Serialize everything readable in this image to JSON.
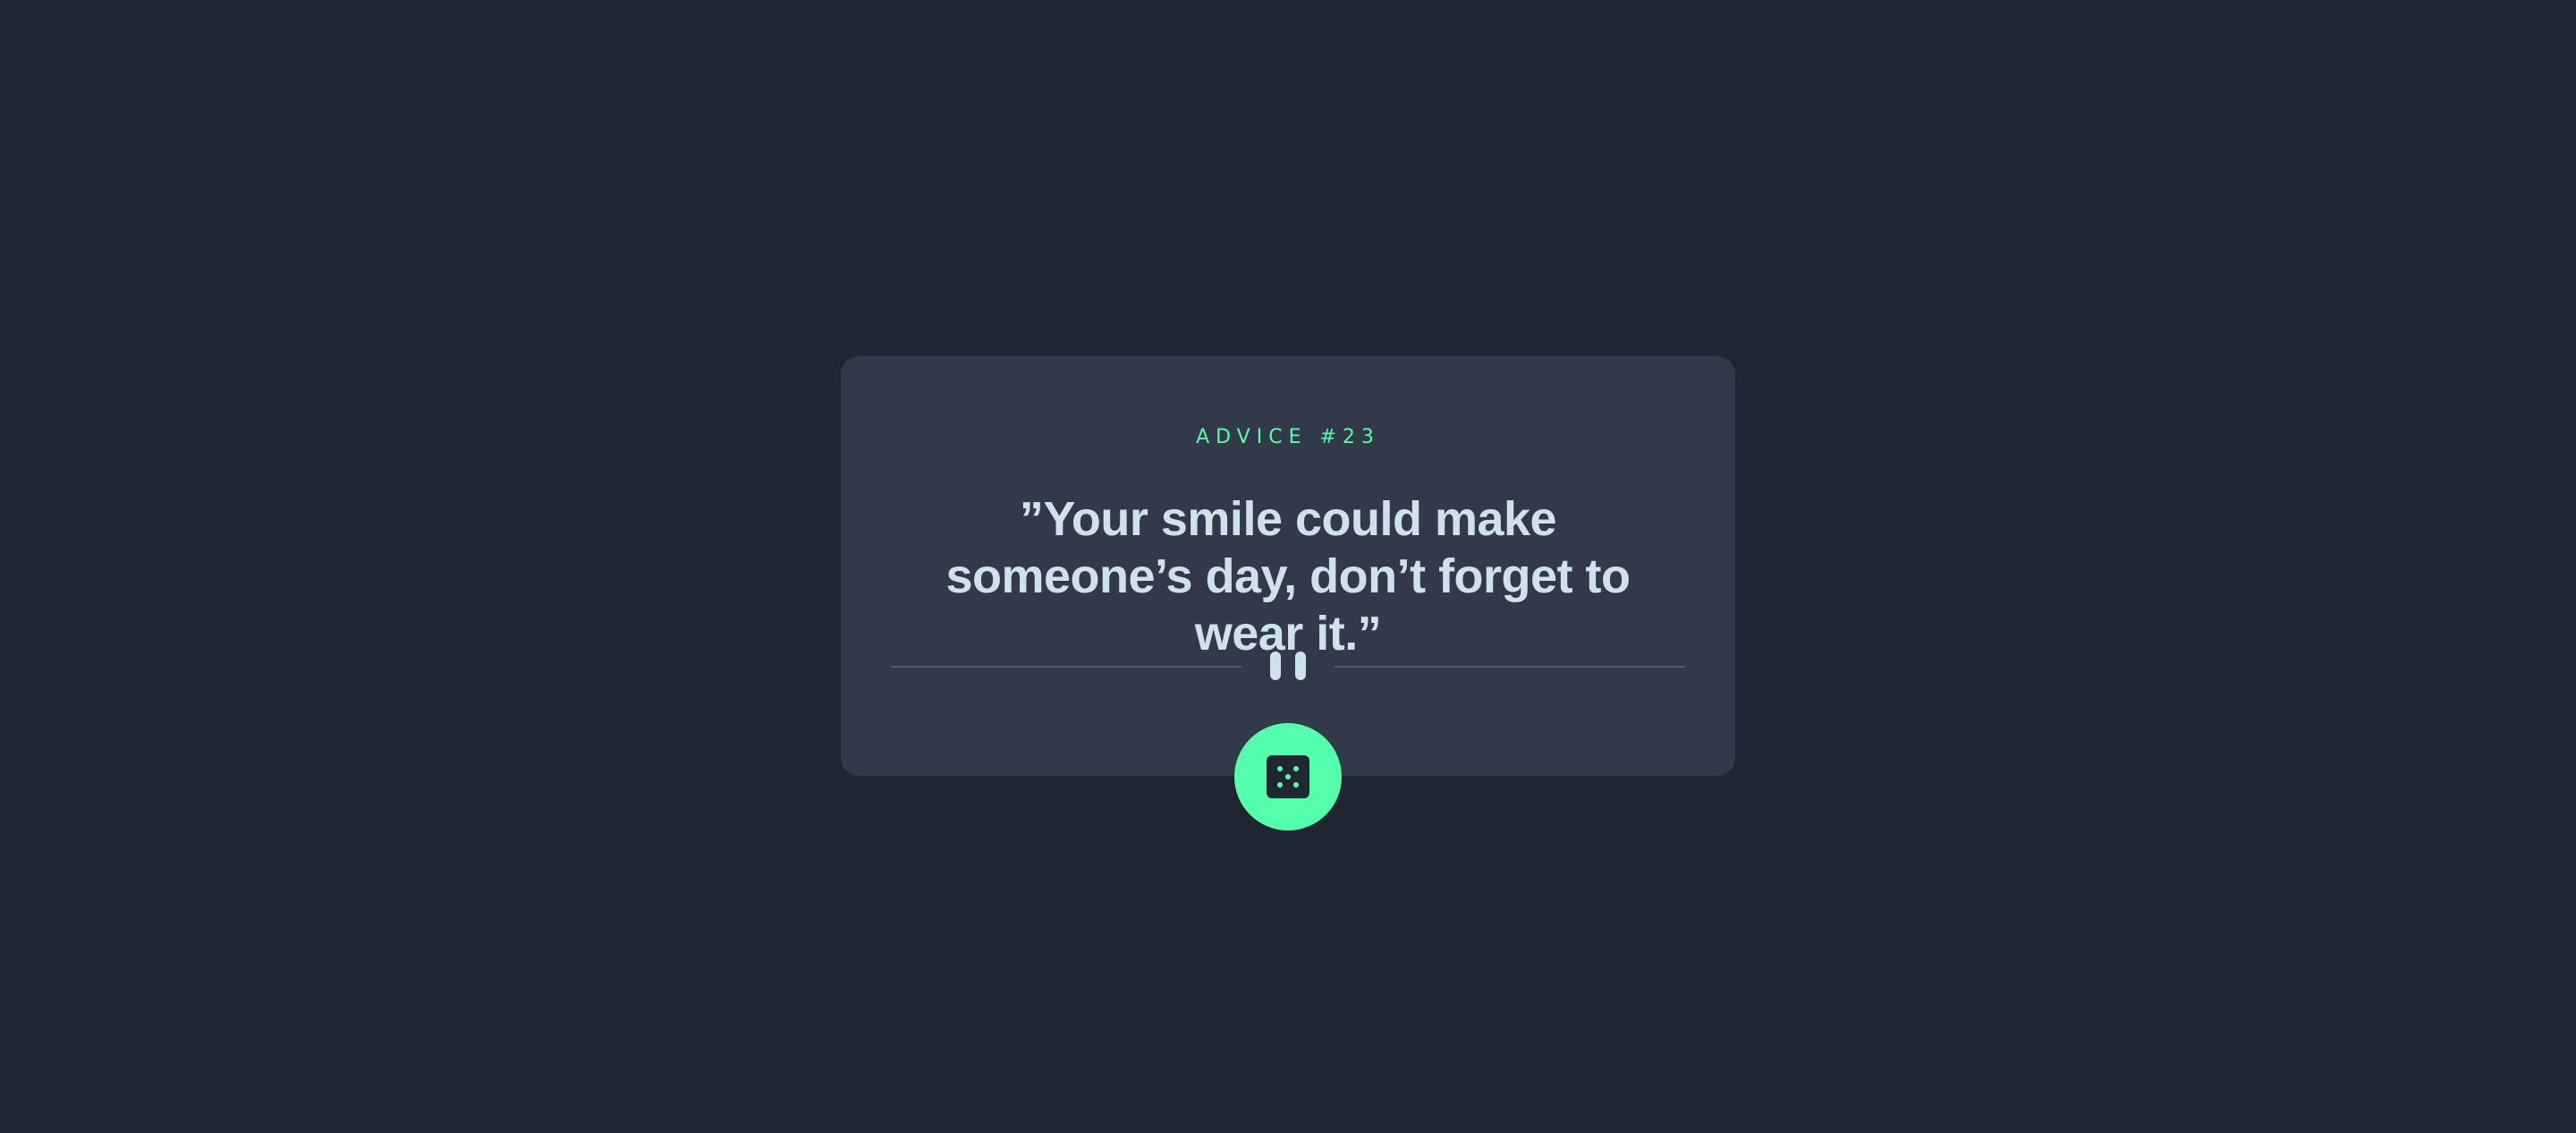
{
  "card": {
    "advice_label": "ADVICE #23",
    "quote": "”Your smile could make someone’s day, don’t forget to wear it.”"
  },
  "icons": {
    "divider": "pause-icon",
    "button": "dice-icon"
  },
  "colors": {
    "background": "#1f2631",
    "card": "#323a49",
    "accent": "#53ffaa",
    "text": "#cee3e9",
    "divider": "#4f5d74"
  }
}
